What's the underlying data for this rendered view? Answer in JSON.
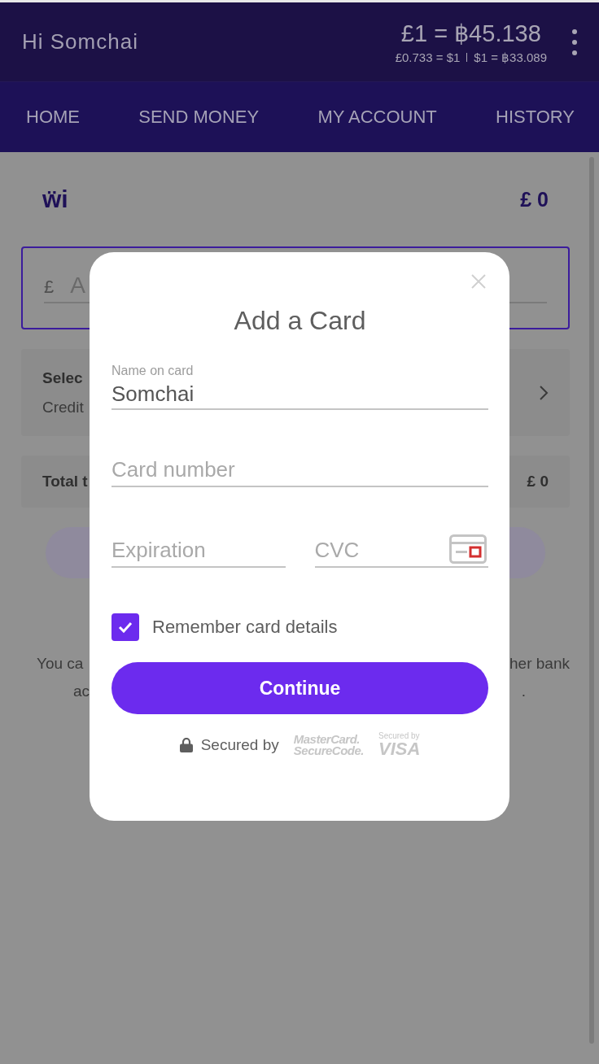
{
  "header": {
    "greeting": "Hi Somchai",
    "rate_main": "£1 = ฿45.138",
    "rate_sub": [
      "£0.733 = $1",
      "$1 = ฿33.089"
    ]
  },
  "nav": [
    {
      "label": "HOME"
    },
    {
      "label": "SEND MONEY"
    },
    {
      "label": "MY ACCOUNT"
    },
    {
      "label": "HISTORY"
    }
  ],
  "summary": {
    "logo": "ẅi",
    "balance": "£ 0"
  },
  "amount_field": {
    "currency": "£",
    "placeholder": "A"
  },
  "select_card": {
    "title": "Selec",
    "subtitle": "Credit"
  },
  "total": {
    "label": "Total t",
    "value": "£ 0"
  },
  "note": {
    "lines": [
      {
        "left": "You ca",
        "right": "her bank"
      },
      {
        "left": "ac",
        "right": "."
      }
    ]
  },
  "dialog": {
    "title": "Add a Card",
    "name_field": {
      "label": "Name on card",
      "value": "Somchai"
    },
    "card_number": {
      "placeholder": "Card number"
    },
    "expiration": {
      "placeholder": "Expiration"
    },
    "cvc": {
      "placeholder": "CVC"
    },
    "remember": {
      "label": "Remember card details",
      "checked": true
    },
    "button": "Continue",
    "secured": {
      "label": "Secured by",
      "mastercard": [
        "MasterCard.",
        "SecureCode."
      ],
      "visa": {
        "caption": "Secured by",
        "name": "VISA"
      }
    }
  }
}
